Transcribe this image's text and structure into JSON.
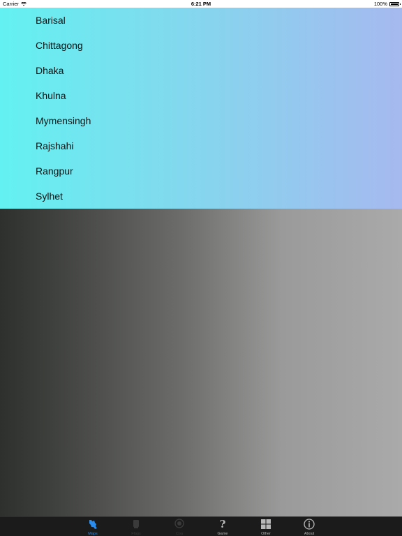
{
  "status_bar": {
    "carrier": "Carrier",
    "time": "6:21 PM",
    "battery": "100%",
    "battery_level": 1.0
  },
  "divisions": [
    "Barisal",
    "Chittagong",
    "Dhaka",
    "Khulna",
    "Mymensingh",
    "Rajshahi",
    "Rangpur",
    "Sylhet"
  ],
  "tab_bar": {
    "tabs": [
      {
        "label": "Maps",
        "icon": "map-icon",
        "state": "selected",
        "color": "#2b8cf0"
      },
      {
        "label": "Flags",
        "icon": "flag-icon",
        "state": "disabled",
        "color": "#3a3a3a"
      },
      {
        "label": "Coa",
        "icon": "emblem-icon",
        "state": "disabled",
        "color": "#3a3a3a"
      },
      {
        "label": "Game",
        "icon": "question-icon",
        "state": "normal",
        "color": "#b8b8b8"
      },
      {
        "label": "Other",
        "icon": "grid-icon",
        "state": "normal",
        "color": "#b8b8b8"
      },
      {
        "label": "About",
        "icon": "info-icon",
        "state": "normal",
        "color": "#b8b8b8"
      }
    ]
  }
}
